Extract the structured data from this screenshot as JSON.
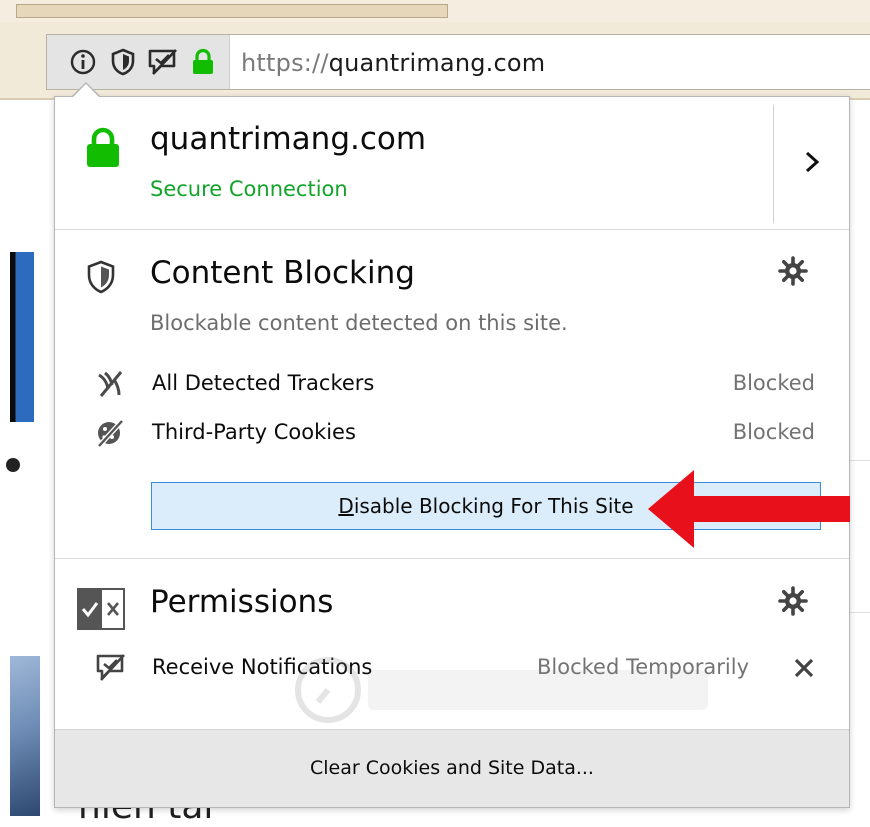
{
  "browser": {
    "url_scheme": "https://",
    "url_host": "quantrimang.com",
    "identity_icons": [
      "info-icon",
      "tracking-shield-icon",
      "notification-blocked-icon",
      "lock-icon"
    ]
  },
  "site_info": {
    "host": "quantrimang.com",
    "connection_status": "Secure Connection",
    "status_color": "#12a52a",
    "expand_icon": "chevron-right-icon"
  },
  "content_blocking": {
    "title": "Content Blocking",
    "description": "Blockable content detected on this site.",
    "settings_icon": "gear-icon",
    "rows": [
      {
        "label": "All Detected Trackers",
        "state": "Blocked",
        "icon": "trackers-blocked-icon"
      },
      {
        "label": "Third-Party Cookies",
        "state": "Blocked",
        "icon": "cookies-blocked-icon"
      }
    ],
    "disable_button": {
      "label": "Disable Blocking For This Site",
      "accesskey": "D"
    },
    "button_color": "#dbecfa"
  },
  "permissions": {
    "title": "Permissions",
    "settings_icon": "gear-icon",
    "rows": [
      {
        "label": "Receive Notifications",
        "state": "Blocked Temporarily",
        "icon": "notification-blocked-icon",
        "remove_icon": "close-icon"
      }
    ]
  },
  "footer": {
    "clear_button": "Clear Cookies and Site Data..."
  },
  "background_text": {
    "heading_fragment": "hien tai"
  },
  "annotation": {
    "arrow_color": "#e8101a"
  }
}
